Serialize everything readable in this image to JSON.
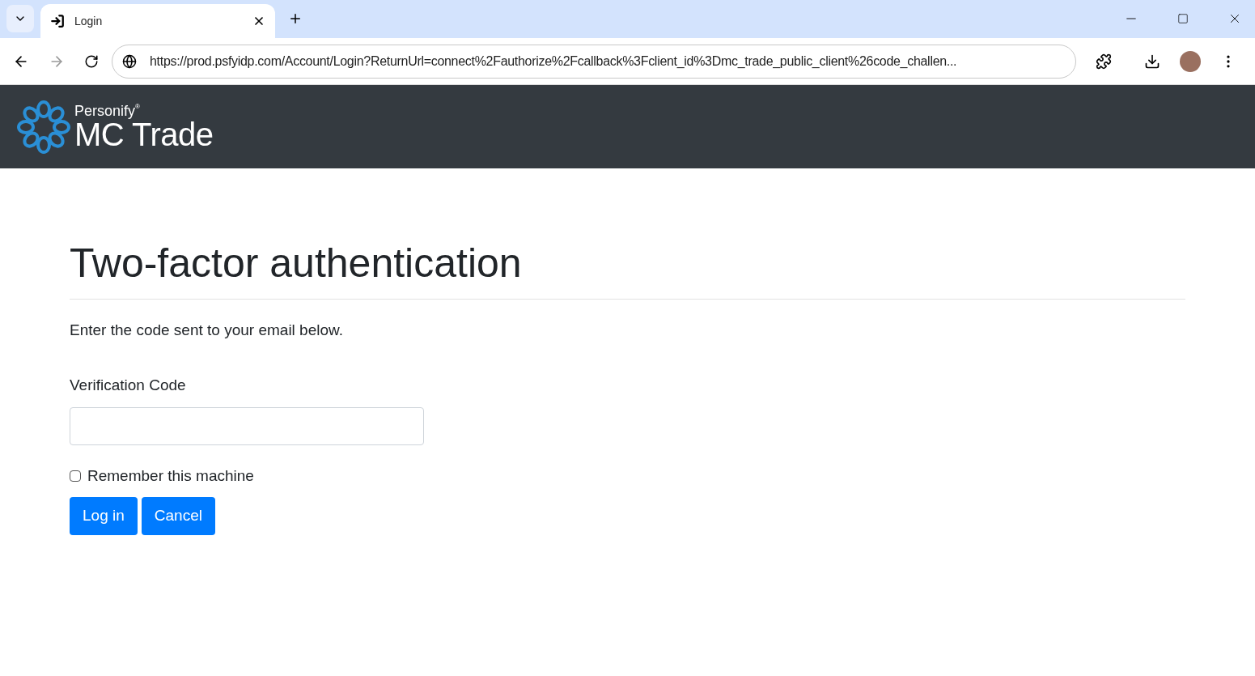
{
  "browser": {
    "tabs": [
      {
        "title": "Login",
        "selected": true
      }
    ],
    "address": "https://prod.psfyidp.com/Account/Login?ReturnUrl=connect%2Fauthorize%2Fcallback%3Fclient_id%3Dmc_trade_public_client%26code_challen..."
  },
  "header": {
    "brand": "Personify",
    "trademark": "®",
    "product": "MC Trade"
  },
  "page": {
    "title": "Two-factor authentication",
    "instruction": "Enter the code sent to your email below.",
    "field": {
      "label": "Verification Code"
    },
    "remember": {
      "label": "Remember this machine",
      "checked": false
    },
    "buttons": [
      "Log in",
      "Cancel"
    ]
  }
}
